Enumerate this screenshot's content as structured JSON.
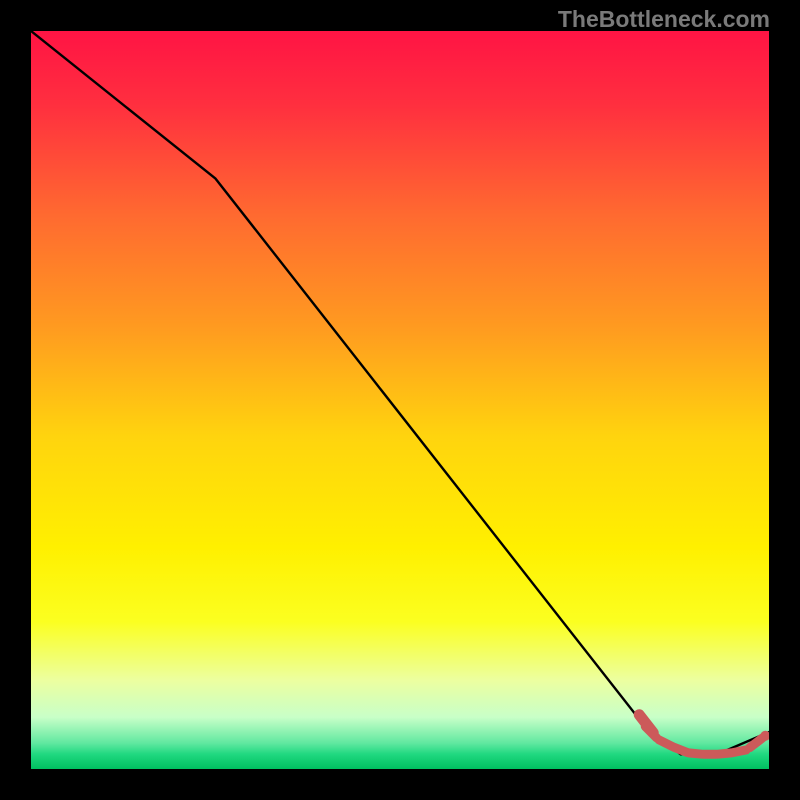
{
  "attribution": "TheBottleneck.com",
  "chart_data": {
    "type": "line",
    "title": "",
    "xlabel": "",
    "ylabel": "",
    "xlim": [
      0,
      100
    ],
    "ylim": [
      0,
      100
    ],
    "series": [
      {
        "name": "main-curve",
        "x": [
          0,
          25,
          83,
          88,
          93,
          100
        ],
        "y": [
          100,
          80,
          6,
          2,
          2,
          5
        ]
      }
    ],
    "dashed_segment": {
      "name": "valley-dashes",
      "x": [
        83,
        85,
        87,
        89,
        91,
        93,
        95,
        97,
        99.5
      ],
      "y": [
        6,
        4,
        3,
        2.2,
        2,
        2,
        2.2,
        2.6,
        4.5
      ]
    },
    "gradient_stops": [
      {
        "offset": 0.0,
        "color": "#ff1444"
      },
      {
        "offset": 0.1,
        "color": "#ff2f3f"
      },
      {
        "offset": 0.25,
        "color": "#ff6a30"
      },
      {
        "offset": 0.4,
        "color": "#ff9a20"
      },
      {
        "offset": 0.55,
        "color": "#ffd40e"
      },
      {
        "offset": 0.7,
        "color": "#fff000"
      },
      {
        "offset": 0.8,
        "color": "#fbff20"
      },
      {
        "offset": 0.88,
        "color": "#ecffa0"
      },
      {
        "offset": 0.93,
        "color": "#c8ffc8"
      },
      {
        "offset": 0.965,
        "color": "#60e8a0"
      },
      {
        "offset": 0.98,
        "color": "#20d880"
      },
      {
        "offset": 1.0,
        "color": "#00c060"
      }
    ],
    "colors": {
      "line": "#000000",
      "dash": "#cc5a5a",
      "dot": "#cc5a5a"
    }
  }
}
